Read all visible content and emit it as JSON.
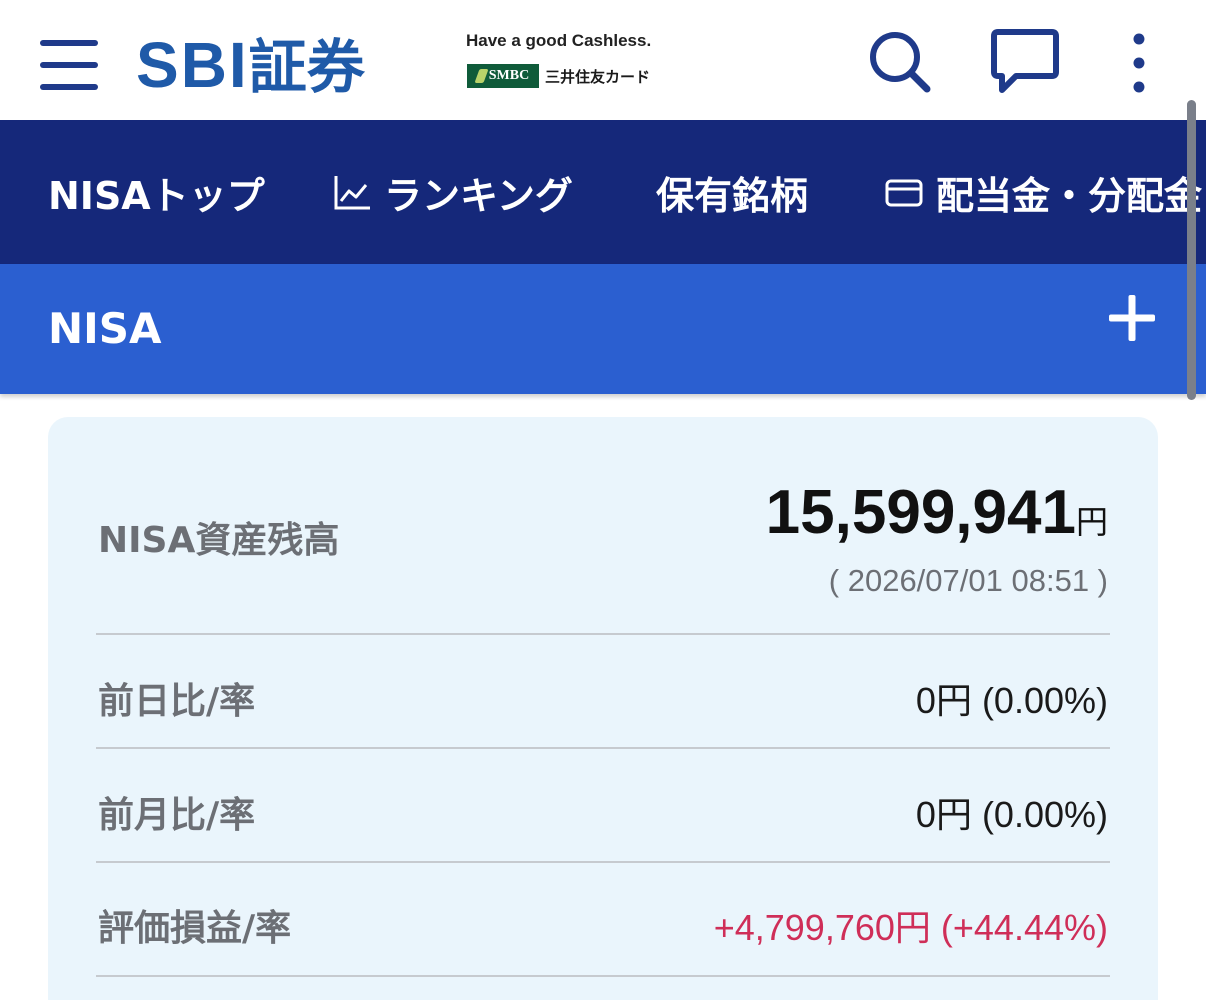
{
  "header": {
    "brand_latin": "SBI",
    "brand_kanji": "証券",
    "slogan": "Have a good Cashless.",
    "partner_logo": "SMBC",
    "partner_name": "三井住友カード",
    "brand_color": "#1f5aa8"
  },
  "nav": {
    "items": [
      {
        "label": "NISAトップ"
      },
      {
        "label": "ランキング",
        "icon": "chart-line-icon"
      },
      {
        "label": "保有銘柄"
      },
      {
        "label": "配当金・分配金",
        "icon": "card-icon"
      }
    ],
    "background": "#15287a"
  },
  "section": {
    "title": "NISA",
    "background": "#2b5fd0"
  },
  "summary": {
    "balance_label": "NISA資産残高",
    "balance_value": "15,599,941",
    "balance_unit": "円",
    "timestamp": "( 2026/07/01 08:51 )",
    "rows": [
      {
        "label": "前日比/率",
        "value": "0円 (0.00%)"
      },
      {
        "label": "前月比/率",
        "value": "0円 (0.00%)"
      },
      {
        "label": "評価損益/率",
        "value": "+4,799,760円 (+44.44%)",
        "color": "#cf2e58"
      }
    ]
  }
}
